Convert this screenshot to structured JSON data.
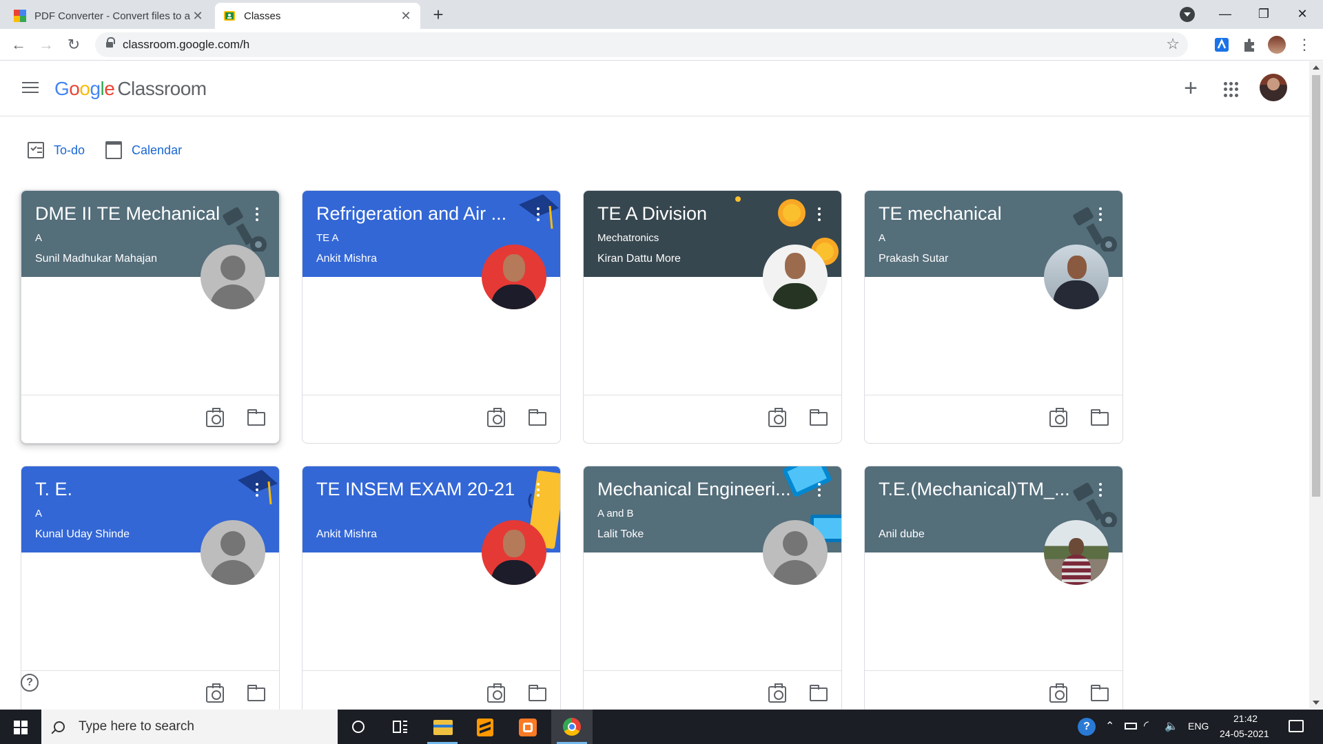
{
  "browser": {
    "tabs": [
      {
        "title": "PDF Converter - Convert files to a",
        "close": "✕",
        "active": false
      },
      {
        "title": "Classes",
        "close": "✕",
        "active": true
      }
    ],
    "new_tab": "+",
    "url": "classroom.google.com/h",
    "window_controls": {
      "minimize": "—",
      "maximize": "❐",
      "close": "✕"
    }
  },
  "app": {
    "logo_google": [
      "G",
      "o",
      "o",
      "g",
      "l",
      "e"
    ],
    "logo_product": "Classroom",
    "create_label": "+"
  },
  "subnav": {
    "todo": "To-do",
    "calendar": "Calendar"
  },
  "classes": [
    {
      "title": "DME II TE Mechanical",
      "section": "A",
      "teacher": "Sunil Madhukar Mahajan",
      "theme_color": "#546e7a",
      "avatar": "default"
    },
    {
      "title": "Refrigeration and Air ...",
      "section": "TE A",
      "teacher": "Ankit Mishra",
      "theme_color": "#3367d6",
      "avatar": "photo-red"
    },
    {
      "title": "TE A Division",
      "section": "Mechatronics",
      "teacher": "Kiran Dattu More",
      "theme_color": "#37474f",
      "avatar": "photo-white"
    },
    {
      "title": "TE mechanical",
      "section": "A",
      "teacher": "Prakash Sutar",
      "theme_color": "#546e7a",
      "avatar": "photo-office"
    },
    {
      "title": "T. E.",
      "section": "A",
      "teacher": "Kunal Uday Shinde",
      "theme_color": "#3367d6",
      "avatar": "default"
    },
    {
      "title": "TE INSEM EXAM 20-21",
      "section": "",
      "teacher": "Ankit Mishra",
      "theme_color": "#3367d6",
      "avatar": "photo-red"
    },
    {
      "title": "Mechanical Engineeri...",
      "section": "A and B",
      "teacher": "Lalit Toke",
      "theme_color": "#546e7a",
      "avatar": "default"
    },
    {
      "title": "T.E.(Mechanical)TM_...",
      "section": "",
      "teacher": "Anil dube",
      "theme_color": "#546e7a",
      "avatar": "photo-outdoor"
    }
  ],
  "help": "?",
  "taskbar": {
    "search_placeholder": "Type here to search",
    "language": "ENG",
    "time": "21:42",
    "date": "24-05-2021"
  },
  "icons": {
    "tab1": "pdf-converter-favicon",
    "tab2": "classroom-favicon",
    "portfolio": "portfolio-icon",
    "folder": "folder-icon"
  }
}
